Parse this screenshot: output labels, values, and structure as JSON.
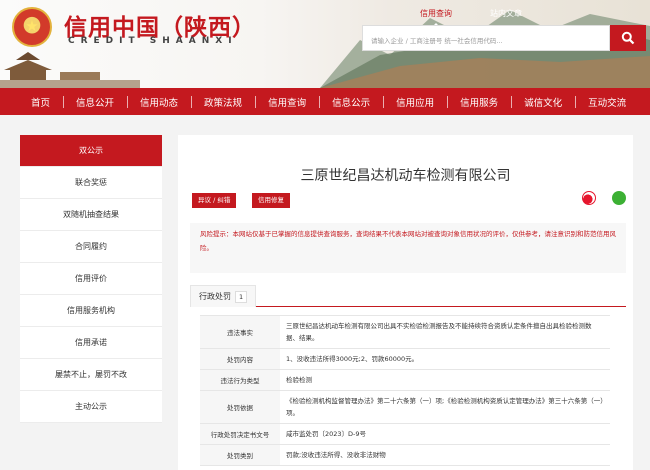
{
  "header": {
    "brand": "信用中国（陕西）",
    "brand_sub": "CREDIT  SHAANXI",
    "search_tabs": [
      "信用查询",
      "站内文章"
    ],
    "search_placeholder": "请输入企业 / 工商注册号 统一社会信用代码..."
  },
  "nav": [
    "首页",
    "信息公开",
    "信用动态",
    "政策法规",
    "信用查询",
    "信息公示",
    "信用应用",
    "信用服务",
    "诚信文化",
    "互动交流"
  ],
  "sidebar": [
    "双公示",
    "联合奖惩",
    "双随机抽查结果",
    "合同履约",
    "信用评价",
    "信用服务机构",
    "信用承诺",
    "屡禁不止，屡罚不改",
    "主动公示"
  ],
  "company": {
    "name": "三原世纪昌达机动车检测有限公司",
    "objection_btn": "异议 / 纠错",
    "repair_btn": "信用修复"
  },
  "warning": "风险提示：本网站仅基于已掌握的信息提供查询服务，查询结果不代表本网站对被查询对象信用状况的评价，仅供参考，请注意识别和防范信用风险。",
  "tab": {
    "label": "行政处罚",
    "count": "1"
  },
  "details": [
    {
      "k": "违法事实",
      "v": "三原世纪昌达机动车检测有限公司出具不实检验检测报告及不能持续符合资质认定条件擅自出具检验检测数据、结果。"
    },
    {
      "k": "处罚内容",
      "v": "1、没收违法所得3000元;2、罚款60000元。"
    },
    {
      "k": "违法行为类型",
      "v": "检验检测"
    },
    {
      "k": "处罚依据",
      "v": "《检验检测机构监督管理办法》第二十六条第（一）项;《检验检测机构资质认定管理办法》第三十六条第（一）项。"
    },
    {
      "k": "行政处罚决定书文号",
      "v": "咸市监处罚〔2023〕D-9号"
    },
    {
      "k": "处罚类别",
      "v": "罚款;没收违法所得、没收非法财物"
    }
  ]
}
